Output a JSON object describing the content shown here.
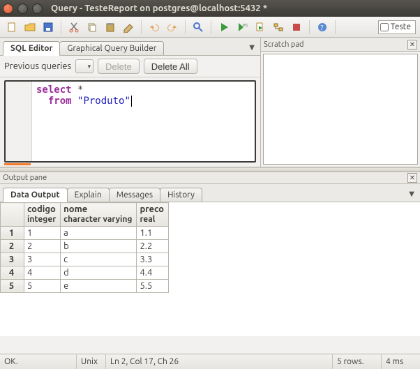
{
  "window": {
    "title": "Query - TesteReport on postgres@localhost:5432 *"
  },
  "toolbar": {
    "teste_label": "Teste"
  },
  "left": {
    "tab_sql": "SQL Editor",
    "tab_gqb": "Graphical Query Builder",
    "prev_label": "Previous queries",
    "delete_label": "Delete",
    "delete_all_label": "Delete All"
  },
  "sql": {
    "kw_select": "select",
    "star": " *",
    "kw_from": "from",
    "str_produto": "\"Produto\""
  },
  "scratch": {
    "title": "Scratch pad"
  },
  "output": {
    "pane_title": "Output pane",
    "tabs": {
      "data": "Data Output",
      "explain": "Explain",
      "messages": "Messages",
      "history": "History"
    },
    "columns": [
      {
        "name": "codigo",
        "type": "integer"
      },
      {
        "name": "nome",
        "type": "character varying"
      },
      {
        "name": "preco",
        "type": "real"
      }
    ],
    "rows": [
      {
        "n": "1",
        "codigo": "1",
        "nome": "a",
        "preco": "1.1"
      },
      {
        "n": "2",
        "codigo": "2",
        "nome": "b",
        "preco": "2.2"
      },
      {
        "n": "3",
        "codigo": "3",
        "nome": "c",
        "preco": "3.3"
      },
      {
        "n": "4",
        "codigo": "4",
        "nome": "d",
        "preco": "4.4"
      },
      {
        "n": "5",
        "codigo": "5",
        "nome": "e",
        "preco": "5.5"
      }
    ]
  },
  "status": {
    "ok": "OK.",
    "encoding": "Unix",
    "position": "Ln 2, Col 17, Ch 26",
    "rows": "5 rows.",
    "time": "4 ms"
  }
}
